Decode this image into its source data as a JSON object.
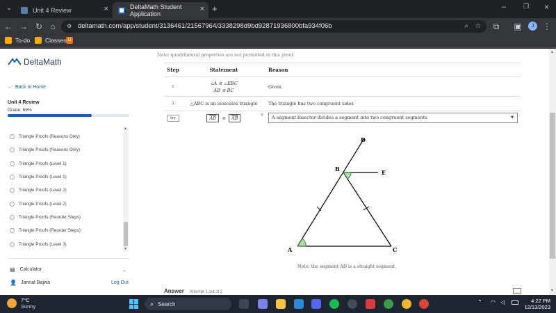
{
  "browser": {
    "tabs": [
      {
        "label": "Unit 4 Review",
        "active": false
      },
      {
        "label": "DeltaMath Student Application",
        "active": true
      }
    ],
    "url": "deltamath.com/app/student/3136461/21567964/3338298d9bd92871936800bfa934f06b",
    "profile_initial": "J",
    "bookmarks": [
      "To-do",
      "Classes"
    ]
  },
  "sidebar": {
    "logo": "DeltaMath",
    "back_label": "Back to Home",
    "unit_title": "Unit 4 Review",
    "grade": "Grade: 69%",
    "grade_progress": 0.69,
    "assignments": [
      "Triangle Proofs (Reasons Only)",
      "Triangle Proofs (Reasons Only)",
      "Triangle Proofs (Level 1)",
      "Triangle Proofs (Level 1)",
      "Triangle Proofs (Level 2)",
      "Triangle Proofs (Level 2)",
      "Triangle Proofs (Reorder Steps)",
      "Triangle Proofs (Reorder Steps)",
      "Triangle Proofs (Level 3)"
    ],
    "calculator_label": "Calculator",
    "user_name": "Jannat Bajwa",
    "logout_label": "Log Out"
  },
  "problem": {
    "note_top": "Note: quadrilateral properties are not permitted in this proof.",
    "headers": {
      "step": "Step",
      "statement": "Statement",
      "reason": "Reason"
    },
    "rows": [
      {
        "step": "1",
        "statement_lines": [
          "∠A ≅ ∠EBC",
          "AB ≅ BC"
        ],
        "reason": "Given"
      },
      {
        "step": "2",
        "statement_lines": [
          "△ABC is an isosceles triangle"
        ],
        "reason": "The triangle has two congruent sides"
      }
    ],
    "try_row": {
      "button": "try",
      "statement_left": "AD",
      "statement_op": "≅",
      "statement_right": "AB",
      "reason_selected": "A segment bisector divides a segment into two congruent segments"
    },
    "diagram_labels": {
      "A": "A",
      "B": "B",
      "C": "C",
      "D": "D",
      "E": "E"
    },
    "diagram_note": "Note: the segment AD is a straight segment.",
    "answer_label": "Answer",
    "attempt_label": "Attempt 1 out of 2"
  },
  "taskbar": {
    "weather_temp": "7°C",
    "weather_desc": "Sunny",
    "search_placeholder": "Search",
    "time": "4:22 PM",
    "date": "12/13/2023"
  },
  "colors": {
    "accent": "#1a5fb4",
    "progress": "#1a5fb4",
    "angle_mark": "#2e8b2e"
  }
}
